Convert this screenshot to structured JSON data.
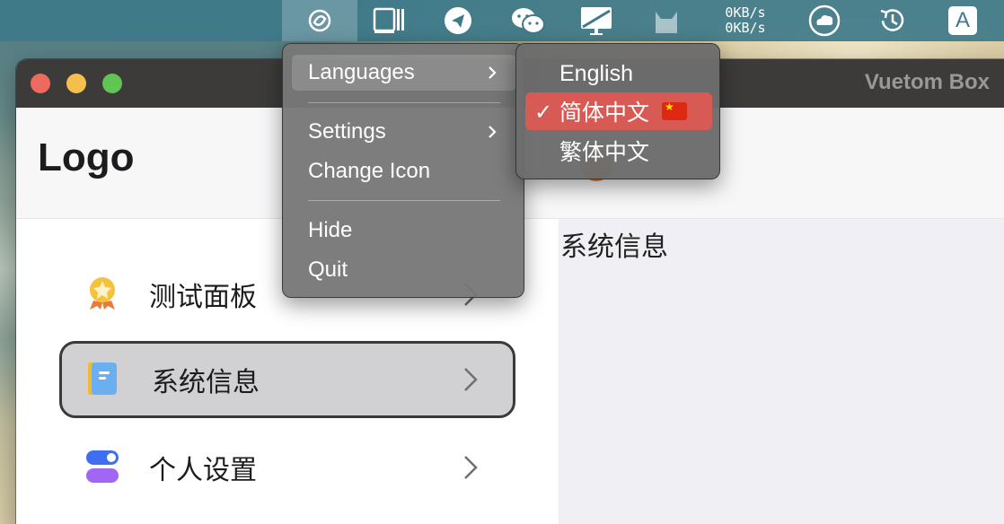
{
  "menubar": {
    "net_up": "0KB/s",
    "net_down": "0KB/s",
    "input_method": "A",
    "icons": [
      "vuetom-tray-icon",
      "sidebar-app-icon",
      "telegram-icon",
      "wechat-icon",
      "screen-mirroring-icon",
      "cat-icon",
      "netspeed-readout",
      "cloud-icon",
      "time-machine-icon",
      "input-source-icon"
    ]
  },
  "window": {
    "title": "Vuetom Box",
    "logo": "Logo",
    "content_title": "系统信息"
  },
  "sidebar": {
    "items": [
      {
        "label": "测试面板",
        "icon": "badge-icon"
      },
      {
        "label": "系统信息",
        "icon": "book-icon",
        "selected": true
      },
      {
        "label": "个人设置",
        "icon": "toggle-icon"
      }
    ]
  },
  "tray_menu": {
    "languages": "Languages",
    "settings": "Settings",
    "change_icon": "Change Icon",
    "hide": "Hide",
    "quit": "Quit"
  },
  "language_submenu": {
    "english": "English",
    "simplified": "简体中文",
    "traditional": "繁体中文",
    "checkmark": "✓"
  },
  "colors": {
    "menubar": "#3e7a8a",
    "selected_language": "#d85a55",
    "window_titlebar": "#3c3b3a"
  }
}
